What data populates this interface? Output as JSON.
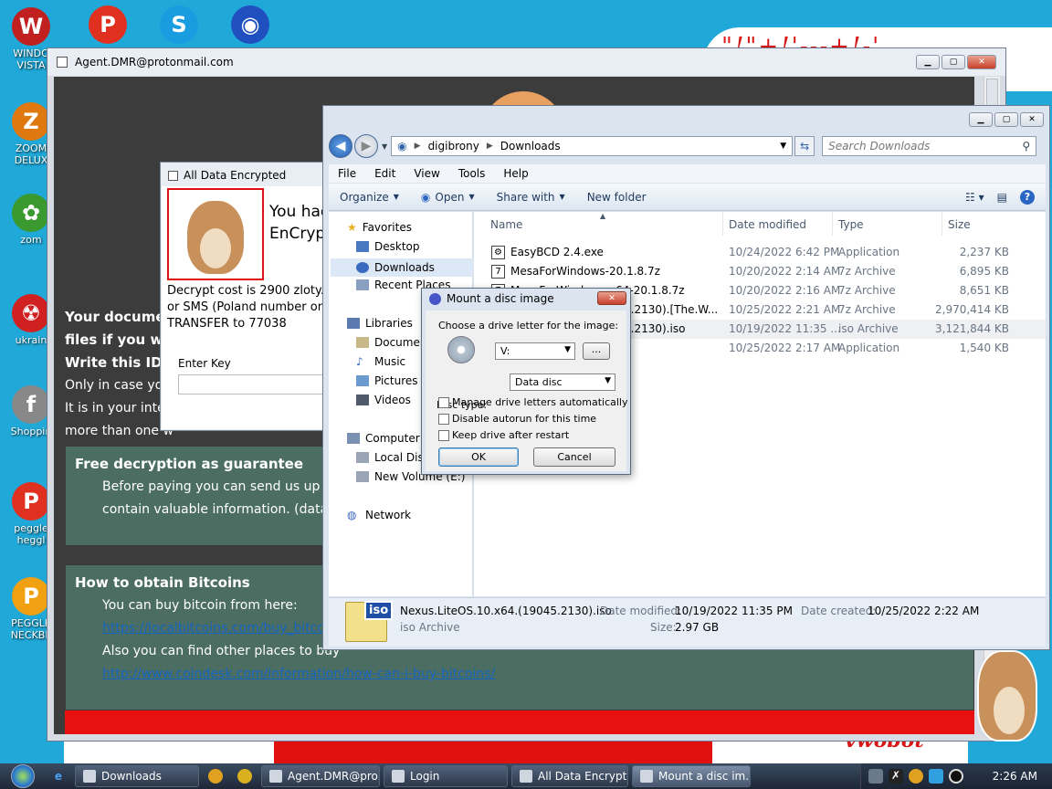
{
  "desktop": {
    "banner_text": "\"!\"+!'---+!-'",
    "bottom_text": "vwobot",
    "icons": [
      {
        "label": "WINDO VISTA",
        "name": "windows-vista-icon",
        "color": "#c02020",
        "glyph": "W"
      },
      {
        "label": "ZOOM DELUX",
        "name": "zoom-deluxe-icon",
        "color": "#e07810",
        "glyph": "Z"
      },
      {
        "label": "zom",
        "name": "zom-icon",
        "color": "#3a9a30",
        "glyph": "✿"
      },
      {
        "label": "ukrain",
        "name": "radiation-icon",
        "color": "#d02020",
        "glyph": "☢"
      },
      {
        "label": "Shoppin",
        "name": "flash-icon",
        "color": "#888",
        "glyph": "f"
      },
      {
        "label": "peggle heggl",
        "name": "peggle-icon",
        "color": "#e03020",
        "glyph": "P"
      },
      {
        "label": "PEGGLE NECKBE",
        "name": "peggle-neckbeard-icon",
        "color": "#f0a010",
        "glyph": "P"
      }
    ],
    "top_icons": [
      {
        "name": "peggle-top-icon",
        "color": "#e03020",
        "glyph": "P"
      },
      {
        "name": "skype-icon",
        "color": "#1a9ce0",
        "glyph": "S"
      },
      {
        "name": "globe-icon",
        "color": "#2050c0",
        "glyph": "◉"
      }
    ]
  },
  "ransom_window": {
    "title": "Agent.DMR@protonmail.com",
    "line1": "Your documen",
    "line2": "files if you wa",
    "line3": "Write this ID i",
    "line4": "Only in case you",
    "line5": "It is in your inter",
    "line6": "more than one w",
    "panel1_title": "Free decryption as guarantee",
    "panel1_line1": "Before paying you can send us up to",
    "panel1_line2": "contain valuable information. (databa",
    "panel2_title": "How to obtain Bitcoins",
    "panel2_line1": "You can buy bitcoin from here:",
    "panel2_link1": "https://localbitcoins.com/buy_bitcoins",
    "panel2_line2": "Also you can find other places to buy",
    "panel2_link2": "http://www.coindesk.com/information/how-can-i-buy-bitcoins/"
  },
  "ade_window": {
    "title": "All Data Encrypted",
    "big_line1": "You had",
    "big_line2": "EnCrypt",
    "small_line1": "Decrypt cost is 2900 zloty. C",
    "small_line2": "or SMS (Poland number onl",
    "small_line3": "TRANSFER to 77038",
    "key_label": "Enter Key"
  },
  "explorer": {
    "path": [
      "digibrony",
      "Downloads"
    ],
    "search_placeholder": "Search Downloads",
    "menu": [
      "File",
      "Edit",
      "View",
      "Tools",
      "Help"
    ],
    "commands": {
      "organize": "Organize",
      "open": "Open",
      "share": "Share with",
      "new_folder": "New folder"
    },
    "nav": {
      "favorites": "Favorites",
      "desktop": "Desktop",
      "downloads": "Downloads",
      "recent": "Recent Places",
      "libraries": "Libraries",
      "documents": "Documen",
      "music": "Music",
      "pictures": "Pictures",
      "videos": "Videos",
      "computer": "Computer",
      "local_disk": "Local Disk",
      "new_volume": "New Volume (E:)",
      "network": "Network"
    },
    "columns": {
      "name": "Name",
      "date": "Date modified",
      "type": "Type",
      "size": "Size"
    },
    "files": [
      {
        "name": "EasyBCD 2.4.exe",
        "date": "10/24/2022 6:42 PM",
        "type": "Application",
        "size": "2,237 KB",
        "icon": "app"
      },
      {
        "name": "MesaForWindows-20.1.8.7z",
        "date": "10/20/2022 2:14 AM",
        "type": "7z Archive",
        "size": "6,895 KB",
        "icon": "7z"
      },
      {
        "name": "MesaForWindows-x64-20.1.8.7z",
        "date": "10/20/2022 2:16 AM",
        "type": "7z Archive",
        "size": "8,651 KB",
        "icon": "7z"
      },
      {
        "name": "5.2130).[The.W...",
        "date": "10/25/2022 2:21 AM",
        "type": "7z Archive",
        "size": "2,970,414 KB",
        "icon": ""
      },
      {
        "name": "5.2130).iso",
        "date": "10/19/2022 11:35 ...",
        "type": "iso Archive",
        "size": "3,121,844 KB",
        "icon": ""
      },
      {
        "name": "",
        "date": "10/25/2022 2:17 AM",
        "type": "Application",
        "size": "1,540 KB",
        "icon": ""
      }
    ],
    "details": {
      "icon_label": "iso",
      "filename": "Nexus.LiteOS.10.x64.(19045.2130).iso",
      "filetype": "iso Archive",
      "modified_label": "Date modified:",
      "modified_value": "10/19/2022 11:35 PM",
      "created_label": "Date created:",
      "created_value": "10/25/2022 2:22 AM",
      "size_label": "Size:",
      "size_value": "2.97 GB"
    }
  },
  "mount_dialog": {
    "title": "Mount a disc image",
    "prompt": "Choose a drive letter for the image:",
    "drive": "V:",
    "browse": "...",
    "disc_type_label": "Disc type:",
    "disc_type": "Data disc",
    "opt1": "Manage drive letters automatically",
    "opt2": "Disable autorun for this time",
    "opt3": "Keep drive after restart",
    "ok": "OK",
    "cancel": "Cancel"
  },
  "taskbar": {
    "buttons": [
      {
        "label": "Downloads",
        "name": "taskbar-downloads",
        "active": false
      },
      {
        "label": "Agent.DMR@pro...",
        "name": "taskbar-agent",
        "active": false
      },
      {
        "label": "Login",
        "name": "taskbar-login",
        "active": false
      },
      {
        "label": "All Data Encrypted",
        "name": "taskbar-all-data-encrypted",
        "active": false
      },
      {
        "label": "Mount a disc im...",
        "name": "taskbar-mount",
        "active": true
      }
    ],
    "clock": "2:26 AM"
  }
}
